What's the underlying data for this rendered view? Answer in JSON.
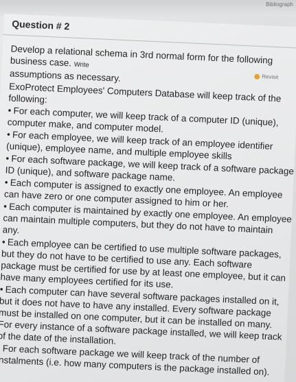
{
  "window": {
    "corner_label": "Bibliograph"
  },
  "question": {
    "heading": "Question # 2",
    "revisit_label": "Revisit",
    "intro_big": "Develop a relational schema in 3rd normal form for the following business case.",
    "intro_small": "Write",
    "intro_line2": "assumptions as necessary.",
    "case_big": "ExoProtect Employees' Computers Database will keep track of the following:",
    "items": [
      {
        "big": "For each computer, we will keep track of a computer ID (unique), computer make, and computer model."
      },
      {
        "big": "For each employee, we will keep track of an employee identifier (unique), employee name, and multiple employee skills"
      },
      {
        "big": "For each software package, we will keep track of a software package ID (unique), and software package name."
      },
      {
        "big": "Each computer is assigned to exactly one employee. An employee can have zero or one computer assigned to him or her."
      },
      {
        "big": "Each computer is maintained by exactly one employee. An employee can maintain multiple computers, but they do not have to maintain any."
      },
      {
        "big": "Each employee can be certified to use multiple software packages, but they do not have to be certified to use any. Each software package must be certified for use by at least one employee, but it can have many employees certified for its use."
      },
      {
        "big": "Each computer can have several software packages installed on it, but it does not have to have any installed. Every software package must be installed on one computer, but it can be installed on many. For every instance of a software package installed, we will keep track of the date of the installation."
      },
      {
        "big": "For each software package we will keep track of the number of instalments (i.e. how many computers is the package installed on)."
      }
    ]
  }
}
